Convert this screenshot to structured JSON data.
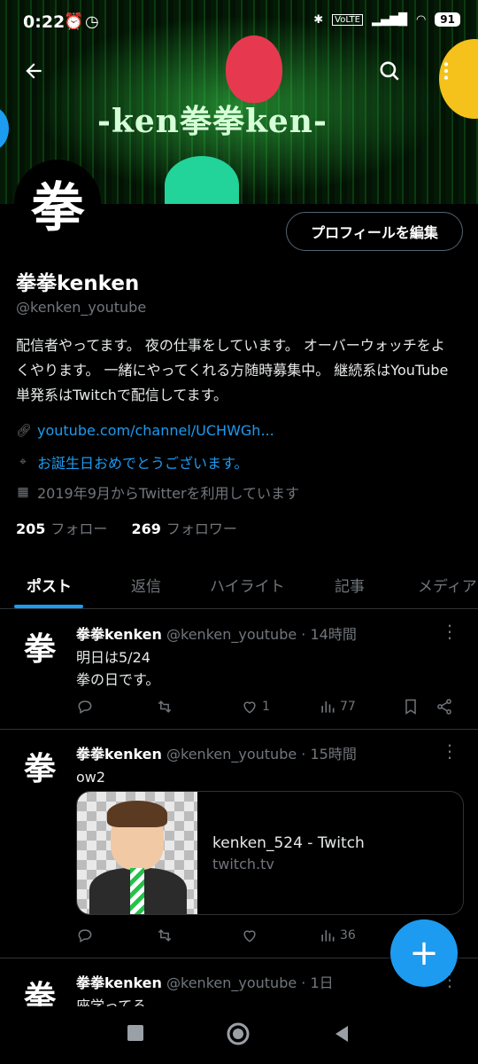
{
  "status_bar": {
    "time": "0:22",
    "battery": "91",
    "network": "VoLTE"
  },
  "banner": {
    "logo_text": "-ken拳拳ken-"
  },
  "header": {
    "back_icon": "arrow-left-icon",
    "search_icon": "search-icon",
    "more_icon": "more-vertical-icon"
  },
  "profile": {
    "avatar_glyph": "拳",
    "edit_button": "プロフィールを編集",
    "name": "拳拳kenken",
    "handle": "@kenken_youtube",
    "bio": "配信者やってます。 夜の仕事をしています。 オーバーウォッチをよくやります。 一緒にやってくれる方随時募集中。 継続系はYouTube 単発系はTwitchで配信してます。",
    "link": "youtube.com/channel/UCHWGh...",
    "birthday": "お誕生日おめでとうございます。",
    "joined": "2019年9月からTwitterを利用しています",
    "following_count": "205",
    "following_label": "フォロー",
    "followers_count": "269",
    "followers_label": "フォロワー"
  },
  "tabs": [
    {
      "label": "ポスト",
      "active": true
    },
    {
      "label": "返信"
    },
    {
      "label": "ハイライト"
    },
    {
      "label": "記事"
    },
    {
      "label": "メディア"
    }
  ],
  "posts": [
    {
      "name": "拳拳kenken",
      "handle": "@kenken_youtube",
      "time": "· 14時間",
      "lines": [
        "明日は5/24",
        "拳の日です。"
      ],
      "likes": "1",
      "views": "77"
    },
    {
      "name": "拳拳kenken",
      "handle": "@kenken_youtube",
      "time": "· 15時間",
      "lines": [
        "ow2"
      ],
      "card_title": "kenken_524 - Twitch",
      "card_domain": "twitch.tv",
      "likes": "",
      "views": "36"
    },
    {
      "name": "拳拳kenken",
      "handle": "@kenken_youtube",
      "time": "· 1日",
      "lines": [
        "座学ってる"
      ]
    }
  ],
  "fab": {
    "icon": "plus-icon",
    "label": "+"
  },
  "colors": {
    "accent": "#1d9bf0",
    "background": "#000000",
    "muted": "#71767b"
  }
}
